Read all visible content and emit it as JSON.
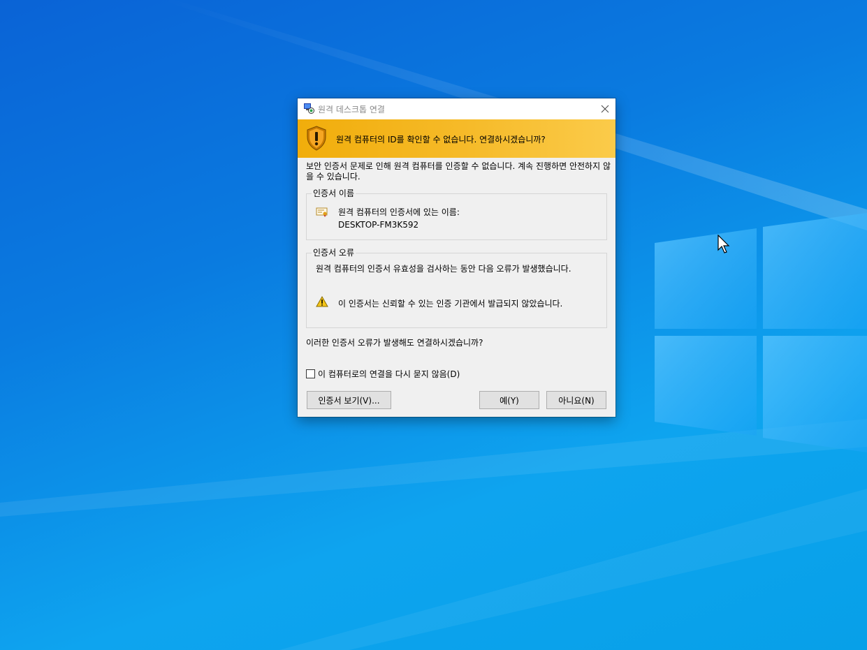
{
  "window": {
    "title": "원격 데스크톱 연결",
    "close_icon": "close-icon"
  },
  "banner": {
    "icon": "shield-warning-icon",
    "message": "원격 컴퓨터의 ID를 확인할 수 없습니다. 연결하시겠습니까?",
    "color_start": "#f1ad0b",
    "color_end": "#fbcb4a"
  },
  "body": {
    "intro": "보안 인증서 문제로 인해 원격 컴퓨터를 인증할 수 없습니다. 계속 진행하면 안전하지 않을 수 있습니다.",
    "cert_name_group": {
      "legend": "인증서 이름",
      "icon": "certificate-icon",
      "label": "원격 컴퓨터의 인증서에 있는 이름:",
      "value": "DESKTOP-FM3K592"
    },
    "cert_error_group": {
      "legend": "인증서 오류",
      "description": "원격 컴퓨터의 인증서 유효성을 검사하는 동안 다음 오류가 발생했습니다.",
      "items": [
        {
          "icon": "warning-icon",
          "text": "이 인증서는 신뢰할 수 있는 인증 기관에서 발급되지 않았습니다."
        }
      ]
    },
    "question": "이러한 인증서 오류가 발생해도 연결하시겠습니까?",
    "dont_ask_checkbox": {
      "label": "이 컴퓨터로의 연결을 다시 묻지 않음(D)",
      "checked": false
    }
  },
  "buttons": {
    "view_cert": "인증서 보기(V)...",
    "yes": "예(Y)",
    "no": "아니요(N)"
  },
  "desktop": {
    "wallpaper": "windows-10-logo-wallpaper",
    "background_color": "#0a7be0"
  }
}
